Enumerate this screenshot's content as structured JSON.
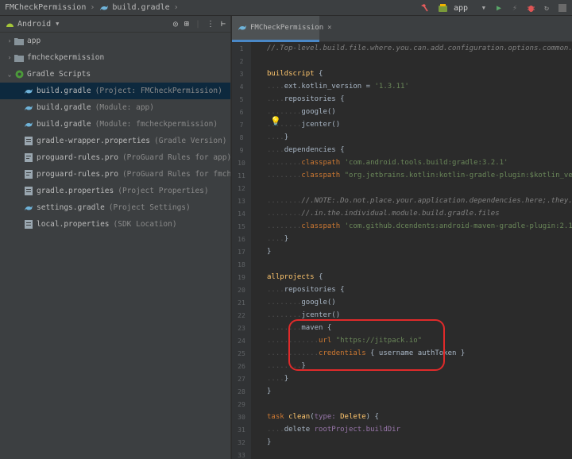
{
  "navbar": {
    "breadcrumbs": [
      "FMCheckPermission",
      "build.gradle"
    ],
    "run_config": "app"
  },
  "project_panel": {
    "view_mode": "Android",
    "items": [
      {
        "name": "app",
        "hint": ""
      },
      {
        "name": "fmcheckpermission",
        "hint": ""
      },
      {
        "name": "Gradle Scripts",
        "hint": ""
      },
      {
        "name": "build.gradle",
        "hint": "(Project: FMCheckPermission)"
      },
      {
        "name": "build.gradle",
        "hint": "(Module: app)"
      },
      {
        "name": "build.gradle",
        "hint": "(Module: fmcheckpermission)"
      },
      {
        "name": "gradle-wrapper.properties",
        "hint": "(Gradle Version)"
      },
      {
        "name": "proguard-rules.pro",
        "hint": "(ProGuard Rules for app)"
      },
      {
        "name": "proguard-rules.pro",
        "hint": "(ProGuard Rules for fmcheckpermissio"
      },
      {
        "name": "gradle.properties",
        "hint": "(Project Properties)"
      },
      {
        "name": "settings.gradle",
        "hint": "(Project Settings)"
      },
      {
        "name": "local.properties",
        "hint": "(SDK Location)"
      }
    ]
  },
  "editor": {
    "tab_label": "FMCheckPermission",
    "line_numbers": [
      "1",
      "2",
      "3",
      "4",
      "5",
      "6",
      "7",
      "8",
      "9",
      "10",
      "11",
      "12",
      "13",
      "14",
      "15",
      "16",
      "17",
      "18",
      "19",
      "20",
      "21",
      "22",
      "23",
      "24",
      "25",
      "26",
      "27",
      "28",
      "29",
      "30",
      "31",
      "32",
      "33"
    ],
    "code": {
      "l1": "//.Top-level.build.file.where.you.can.add.configuration.options.common.to.all.sub-pro",
      "l3_kw": "buildscript",
      "l4_a": "ext.kotlin_version",
      "l4_b": "'1.3.11'",
      "l5": "repositories",
      "l6": "google()",
      "l7": "jcenter()",
      "l9": "dependencies",
      "l10_kw": "classpath",
      "l10_str": "'com.android.tools.build:gradle:3.2.1'",
      "l11_kw": "classpath",
      "l11_str": "\"org.jetbrains.kotlin:kotlin-gradle-plugin:$kotlin_version\"",
      "l13": "//.NOTE:.Do.not.place.your.application.dependencies.here;.they.belong",
      "l14": "//.in.the.individual.module.build.gradle.files",
      "l15_kw": "classpath",
      "l15_str": "'com.github.dcendents:android-maven-gradle-plugin:2.1'",
      "l19": "allprojects",
      "l20": "repositories",
      "l21": "google()",
      "l22": "jcenter()",
      "l23": "maven",
      "l24_kw": "url",
      "l24_str": "\"https://jitpack.io\"",
      "l25_kw": "credentials",
      "l25_a": "username",
      "l25_b": "authToken",
      "l30_kw": "task",
      "l30_fn": "clean",
      "l30_type": "type:",
      "l30_val": "Delete",
      "l31_a": "delete",
      "l31_b": "rootProject.buildDir"
    }
  },
  "colors": {
    "accent": "#4a88c7",
    "highlight_ring": "#e02a2a",
    "keyword": "#cc7832",
    "string": "#6a8759"
  }
}
